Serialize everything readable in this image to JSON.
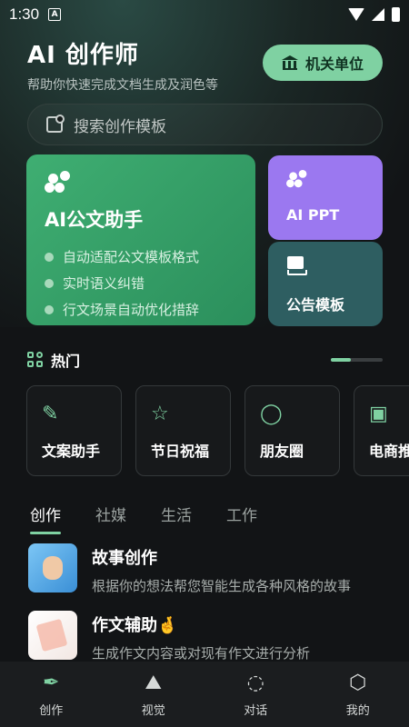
{
  "status_bar": {
    "time": "1:30",
    "notification_badge": "A"
  },
  "header": {
    "title": "AI 创作师",
    "subtitle": "帮助你快速完成文档生成及润色等",
    "org_button_label": "机关单位"
  },
  "search": {
    "placeholder": "搜索创作模板"
  },
  "feature_cards": {
    "main": {
      "title": "AI公文助手",
      "features": [
        "自动适配公文模板格式",
        "实时语义纠错",
        "行文场景自动优化措辞"
      ]
    },
    "ppt": {
      "title": "AI PPT"
    },
    "notice": {
      "title": "公告模板"
    }
  },
  "hot": {
    "title": "热门",
    "scroll_progress": 0.38,
    "items": [
      {
        "label": "文案助手",
        "icon": "pen-sparkle-icon"
      },
      {
        "label": "节日祝福",
        "icon": "star-sparkle-icon"
      },
      {
        "label": "朋友圈",
        "icon": "chat-search-icon"
      },
      {
        "label": "电商推",
        "icon": "package-icon"
      }
    ]
  },
  "tabs": [
    "创作",
    "社媒",
    "生活",
    "工作"
  ],
  "list": [
    {
      "title": "故事创作",
      "desc": "根据你的想法帮您智能生成各种风格的故事"
    },
    {
      "title": "作文辅助🤞",
      "desc": "生成作文内容或对现有作文进行分析"
    }
  ],
  "bottom_nav": [
    {
      "label": "创作",
      "icon": "feather-icon",
      "active": true
    },
    {
      "label": "视觉",
      "icon": "mountain-sparkle-icon",
      "active": false
    },
    {
      "label": "对话",
      "icon": "chat-bubble-icon",
      "active": false
    },
    {
      "label": "我的",
      "icon": "hexagon-icon",
      "active": false
    }
  ],
  "colors": {
    "accent": "#7fd1a2",
    "main_card": "#3fae72",
    "ppt_card": "#9b78f0",
    "notice_card": "#2e5e61",
    "background": "#121416"
  }
}
